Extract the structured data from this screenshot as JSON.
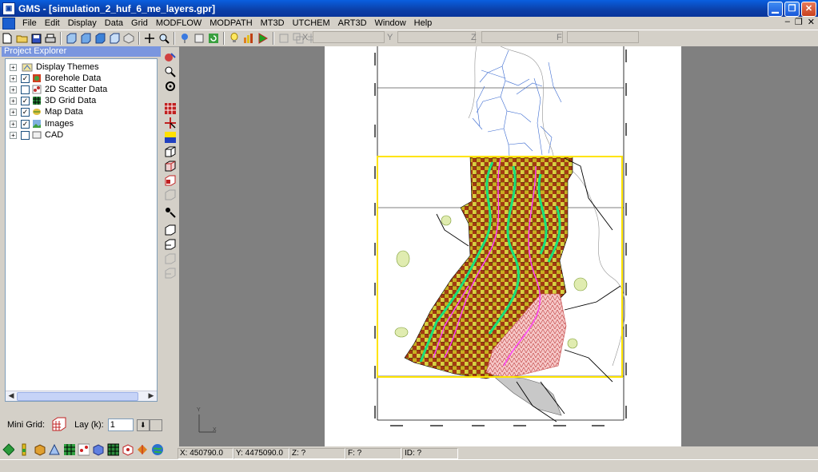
{
  "window": {
    "title": "GMS - [simulation_2_huf_6_me_layers.gpr]"
  },
  "menu": [
    "File",
    "Edit",
    "Display",
    "Data",
    "Grid",
    "MODFLOW",
    "MODPATH",
    "MT3D",
    "UTCHEM",
    "ART3D",
    "Window",
    "Help"
  ],
  "coords": {
    "x_label": "X",
    "y_label": "Y",
    "z_label": "Z",
    "f_label": "F"
  },
  "explorer": {
    "title": "Project Explorer",
    "items": [
      {
        "label": "Display Themes",
        "checked": null
      },
      {
        "label": "Borehole Data",
        "checked": true
      },
      {
        "label": "2D Scatter Data",
        "checked": false
      },
      {
        "label": "3D Grid Data",
        "checked": true
      },
      {
        "label": "Map Data",
        "checked": true
      },
      {
        "label": "Images",
        "checked": true
      },
      {
        "label": "CAD",
        "checked": false
      }
    ]
  },
  "minigrid": {
    "label": "Mini Grid:",
    "lay_label": "Lay (k):",
    "lay_value": "1"
  },
  "status": {
    "x": "X: 450790.0",
    "y": "Y: 4475090.0",
    "z": "Z: ?",
    "f": "F: ?",
    "id": "ID: ?"
  },
  "axis_triad": {
    "y": "Y",
    "x": "X"
  },
  "colors": {
    "grid_dark": "#a0280a",
    "grid_light": "#d8c81a",
    "river": "#19e07a",
    "path": "#ff40ff",
    "hatch": "#e07a7a",
    "bbox": "#ffe400"
  }
}
